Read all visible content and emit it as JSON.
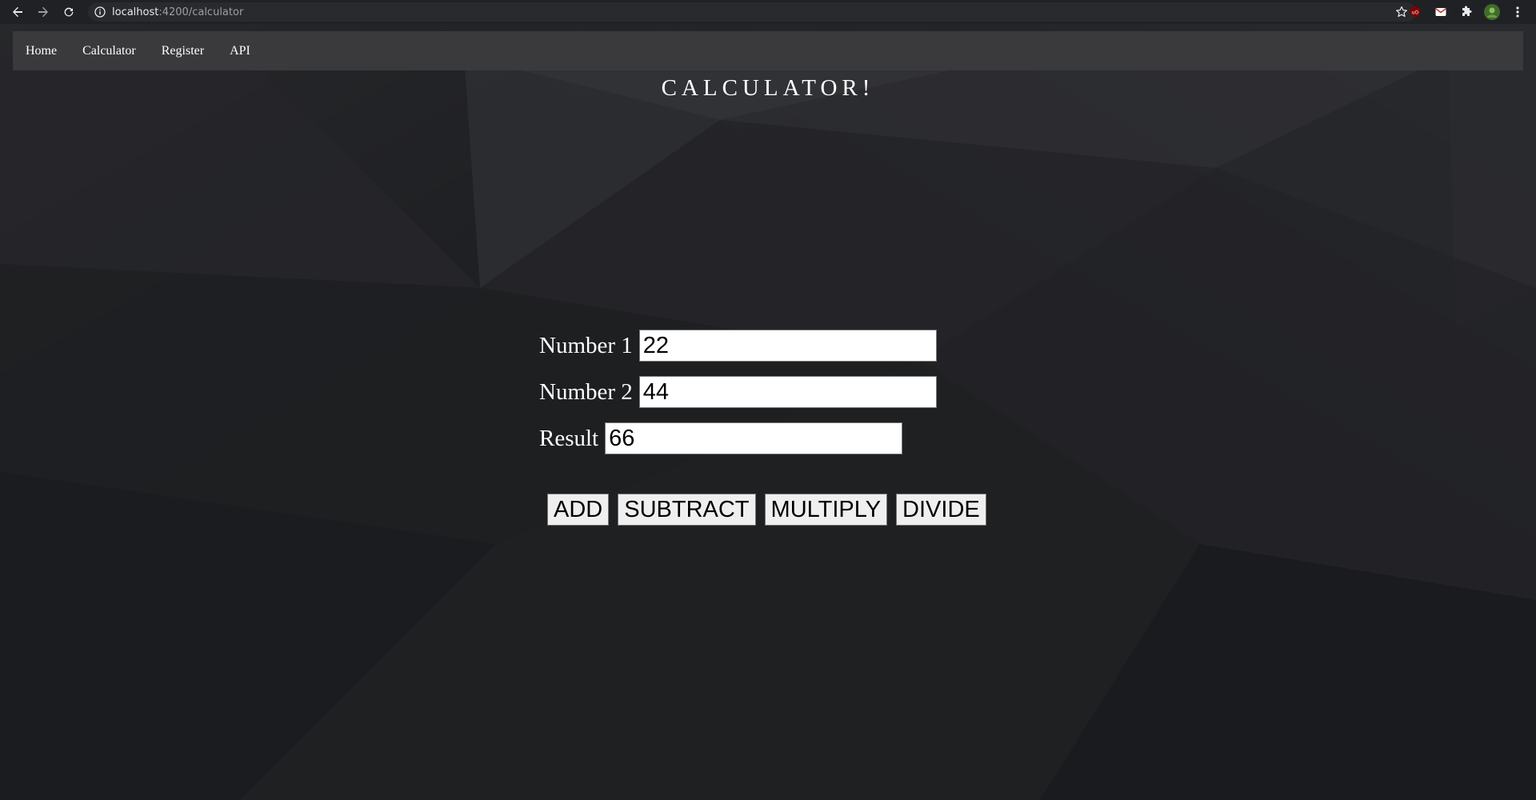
{
  "browser": {
    "url_host": "localhost",
    "url_path": ":4200/calculator",
    "icons": {
      "back": "back-arrow-icon",
      "forward": "forward-arrow-icon",
      "reload": "reload-icon",
      "info": "info-icon",
      "star": "star-icon",
      "extensions": [
        "ublock-extension-icon",
        "gmail-extension-icon",
        "puzzle-extension-icon",
        "profile-avatar-icon",
        "menu-kebab-icon"
      ]
    }
  },
  "navbar": {
    "items": [
      {
        "label": "Home"
      },
      {
        "label": "Calculator"
      },
      {
        "label": "Register"
      },
      {
        "label": "API"
      }
    ]
  },
  "page": {
    "title": "CALCULATOR!"
  },
  "form": {
    "number1": {
      "label": "Number 1",
      "value": "22"
    },
    "number2": {
      "label": "Number 2",
      "value": "44"
    },
    "result": {
      "label": "Result",
      "value": "66"
    }
  },
  "actions": {
    "add": "ADD",
    "subtract": "SUBTRACT",
    "multiply": "MULTIPLY",
    "divide": "DIVIDE"
  },
  "colors": {
    "browser_chrome": "#202124",
    "navbar_bg": "#3a3a3c",
    "page_bg": "#1e1f22",
    "text": "#ffffff"
  }
}
